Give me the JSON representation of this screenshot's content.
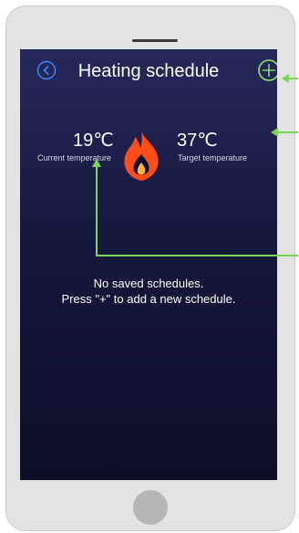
{
  "header": {
    "title": "Heating schedule",
    "back_icon": "back-chevron-icon",
    "add_icon": "plus-circle-icon"
  },
  "temperatures": {
    "current": {
      "value": "19℃",
      "label": "Current temperature"
    },
    "target": {
      "value": "37℃",
      "label": "Target temperature"
    },
    "flame_icon": "flame-icon"
  },
  "empty_state": {
    "line1": "No saved schedules.",
    "line2": "Press \"+\" to add a new schedule."
  },
  "colors": {
    "accent": "#3d8bff",
    "annotation": "#7ad655",
    "flame_outer": "#ff4d1a",
    "flame_inner": "#ffb347"
  }
}
